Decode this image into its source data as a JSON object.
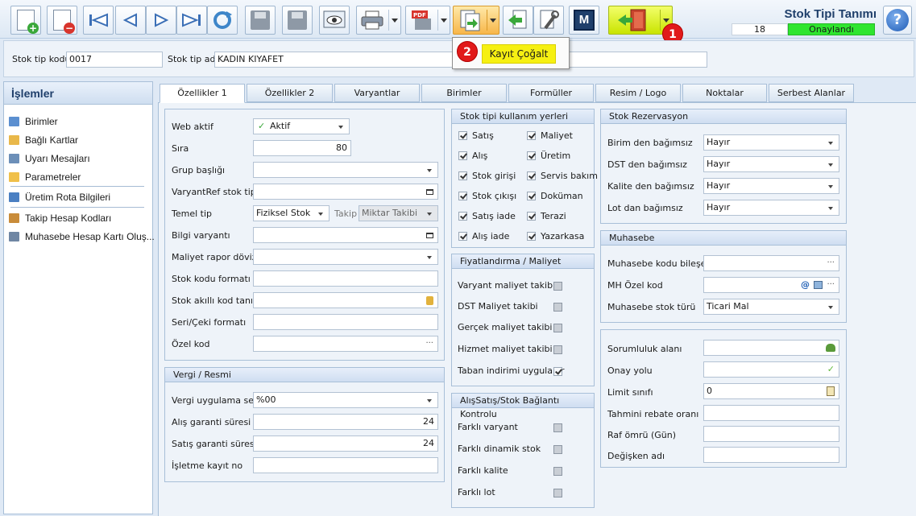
{
  "toolbar": {
    "buttons": [
      {
        "name": "new-record-button",
        "icon": "new-document-icon"
      },
      {
        "name": "delete-record-button",
        "icon": "delete-document-icon"
      },
      {
        "name": "first-record-button",
        "icon": "first-icon"
      },
      {
        "name": "prev-record-button",
        "icon": "previous-icon"
      },
      {
        "name": "next-record-button",
        "icon": "next-icon"
      },
      {
        "name": "last-record-button",
        "icon": "last-icon"
      },
      {
        "name": "refresh-button",
        "icon": "refresh-icon"
      },
      {
        "name": "save-button",
        "icon": "save-icon"
      },
      {
        "name": "save-close-button",
        "icon": "save-close-icon"
      },
      {
        "name": "preview-button",
        "icon": "preview-icon"
      },
      {
        "name": "print-button",
        "icon": "printer-icon"
      },
      {
        "name": "pdf-export-button",
        "icon": "pdf-icon"
      },
      {
        "name": "duplicate-button",
        "icon": "duplicate-icon"
      },
      {
        "name": "back-button",
        "icon": "back-arrow-icon"
      },
      {
        "name": "tools-button",
        "icon": "wrench-icon"
      },
      {
        "name": "m-button",
        "icon": "m-icon"
      },
      {
        "name": "exit-button",
        "icon": "exit-door-icon"
      }
    ],
    "m_label": "M",
    "pdf_label": "PDF"
  },
  "header": {
    "title": "Stok Tipi Tanımı",
    "record_number": "18",
    "status": "Onaylandı",
    "status_color": "#2fe52f",
    "help_label": "?"
  },
  "markers": {
    "one": "1",
    "two": "2"
  },
  "popup": {
    "item_label": "Kayıt Çoğalt",
    "highlight_color": "#f6f012"
  },
  "fields": {
    "code_label": "Stok tip kodu",
    "code_value": "0017",
    "name_label": "Stok tip adı",
    "name_value": "KADIN KIYAFET"
  },
  "left_panel": {
    "title": "İşlemler",
    "items": [
      {
        "label": "Birimler",
        "icon": "grid-icon"
      },
      {
        "label": "Bağlı Kartlar",
        "icon": "folder-icon"
      },
      {
        "label": "Uyarı Mesajları",
        "icon": "warning-icon"
      },
      {
        "label": "Parametreler",
        "icon": "checklist-icon"
      },
      {
        "label": "Üretim Rota Bilgileri",
        "icon": "route-icon"
      },
      {
        "label": "Takip Hesap Kodları",
        "icon": "ledger-icon"
      },
      {
        "label": "Muhasebe Hesap Kartı Oluş...",
        "icon": "accounting-icon"
      }
    ]
  },
  "tabs": [
    "Özellikler 1",
    "Özellikler 2",
    "Varyantlar",
    "Birimler",
    "Formüller",
    "Resim / Logo",
    "Noktalar",
    "Serbest Alanlar"
  ],
  "general": {
    "web_aktif_label": "Web aktif",
    "web_aktif_value": "Aktif",
    "sira_label": "Sıra",
    "sira_value": "80",
    "grup_label": "Grup başlığı",
    "varyantref_label": "VaryantRef stok tipi",
    "temel_tip_label": "Temel tip",
    "temel_tip_value": "Fiziksel Stok",
    "takip_label": "Takip",
    "takip_value": "Miktar Takibi",
    "bilgi_label": "Bilgi varyantı",
    "maliyet_doviz_label": "Maliyet rapor dövizi",
    "stok_kodu_formati_label": "Stok kodu formatı",
    "akilli_kod_label": "Stok akıllı kod tanımı",
    "seri_label": "Seri/Çeki formatı",
    "ozel_kod_label": "Özel kod"
  },
  "vergi": {
    "title": "Vergi / Resmi",
    "set_label": "Vergi uygulama seti",
    "set_value": "%00",
    "alis_label": "Alış garanti süresi",
    "alis_value": "24",
    "satis_label": "Satış garanti süresi",
    "satis_value": "24",
    "isletme_label": "İşletme kayıt no"
  },
  "kullanim": {
    "title": "Stok tipi kullanım yerleri",
    "left": [
      {
        "label": "Satış",
        "checked": true
      },
      {
        "label": "Alış",
        "checked": true
      },
      {
        "label": "Stok girişi",
        "checked": true
      },
      {
        "label": "Stok çıkışı",
        "checked": true
      },
      {
        "label": "Satış iade",
        "checked": true
      },
      {
        "label": "Alış iade",
        "checked": true
      }
    ],
    "right": [
      {
        "label": "Maliyet",
        "checked": true
      },
      {
        "label": "Üretim",
        "checked": true
      },
      {
        "label": "Servis bakım",
        "checked": true
      },
      {
        "label": "Doküman",
        "checked": true
      },
      {
        "label": "Terazi",
        "checked": true
      },
      {
        "label": "Yazarkasa",
        "checked": true
      }
    ]
  },
  "fiyat": {
    "title": "Fiyatlandırma / Maliyet",
    "items": [
      {
        "label": "Varyant maliyet takibi",
        "checked": false
      },
      {
        "label": "DST Maliyet takibi",
        "checked": false
      },
      {
        "label": "Gerçek maliyet takibi",
        "checked": false
      },
      {
        "label": "Hizmet maliyet takibi",
        "checked": false
      },
      {
        "label": "Taban indirimi uygulanır",
        "checked": true
      }
    ]
  },
  "alis_satis": {
    "title": "AlışSatış/Stok Bağlantı Kontrolu",
    "items": [
      {
        "label": "Farklı varyant",
        "checked": false
      },
      {
        "label": "Farklı dinamik stok",
        "checked": false
      },
      {
        "label": "Farklı kalite",
        "checked": false
      },
      {
        "label": "Farklı lot",
        "checked": false
      }
    ]
  },
  "rezervasyon": {
    "title": "Stok Rezervasyon",
    "items": [
      {
        "label": "Birim den bağımsız",
        "value": "Hayır"
      },
      {
        "label": "DST den bağımsız",
        "value": "Hayır"
      },
      {
        "label": "Kalite den bağımsız",
        "value": "Hayır"
      },
      {
        "label": "Lot dan bağımsız",
        "value": "Hayır"
      }
    ]
  },
  "muhasebe": {
    "title": "Muhasebe",
    "bilesen_label": "Muhasebe kodu bileşeni",
    "mh_ozel_label": "MH Özel kod",
    "stok_turu_label": "Muhasebe stok türü",
    "stok_turu_value": "Ticari Mal"
  },
  "diger": {
    "sorumluluk_label": "Sorumluluk alanı",
    "onay_label": "Onay yolu",
    "limit_label": "Limit sınıfı",
    "limit_value": "0",
    "rebate_label": "Tahmini rebate oranı",
    "raf_label": "Raf ömrü (Gün)",
    "degisken_label": "Değişken adı"
  }
}
